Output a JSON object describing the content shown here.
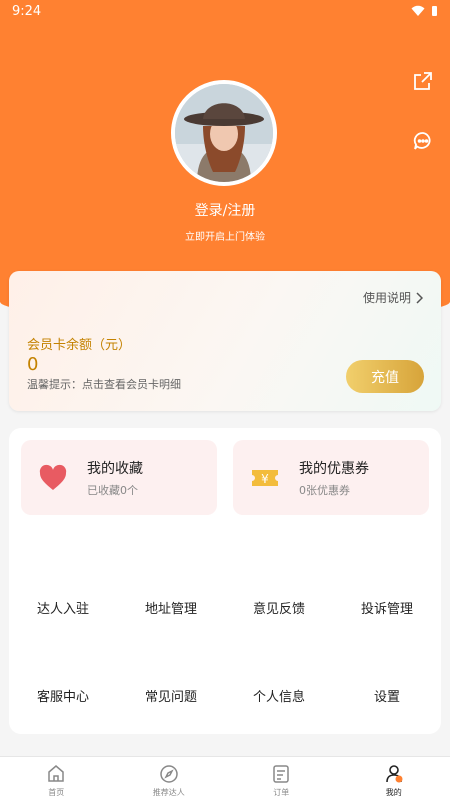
{
  "status_bar": {
    "time": "9:24"
  },
  "profile": {
    "login_label": "登录/注册",
    "subtitle": "立即开启上门体验"
  },
  "member_card": {
    "usage_link": "使用说明",
    "balance_label": "会员卡余额（元）",
    "balance_value": "0",
    "hint": "温馨提示：点击查看会员卡明细",
    "recharge_label": "充值"
  },
  "tiles": [
    {
      "title": "我的收藏",
      "subtitle": "已收藏0个",
      "icon": "heart-icon"
    },
    {
      "title": "我的优惠券",
      "subtitle": "0张优惠券",
      "icon": "coupon-icon"
    }
  ],
  "menu": [
    "达人入驻",
    "地址管理",
    "意见反馈",
    "投诉管理",
    "客服中心",
    "常见问题",
    "个人信息",
    "设置"
  ],
  "tabbar": [
    {
      "label": "首页",
      "icon": "home-icon"
    },
    {
      "label": "推荐达人",
      "icon": "compass-icon"
    },
    {
      "label": "订单",
      "icon": "order-icon"
    },
    {
      "label": "我的",
      "icon": "profile-icon",
      "active": true
    }
  ],
  "colors": {
    "accent": "#ff8131",
    "gold": "#c48200",
    "tile_bg": "#fdf0f0"
  }
}
